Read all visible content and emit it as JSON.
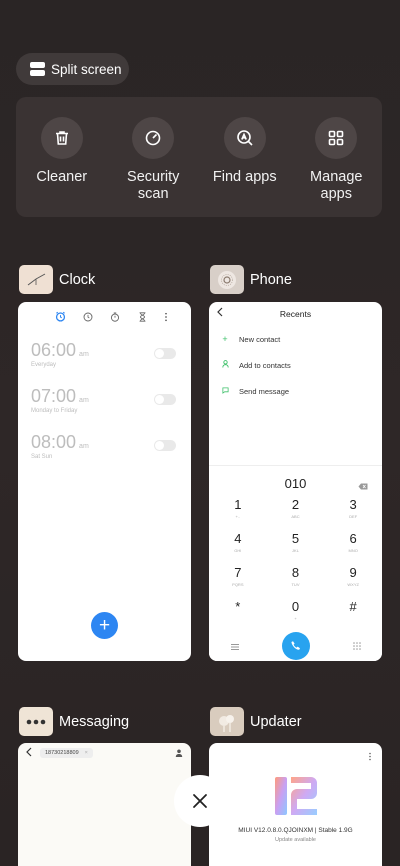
{
  "split_screen": "Split screen",
  "tools": [
    {
      "label": "Cleaner",
      "icon": "trash-icon"
    },
    {
      "label": "Security scan",
      "icon": "shield-scan-icon"
    },
    {
      "label": "Find apps",
      "icon": "search-apps-icon"
    },
    {
      "label": "Manage apps",
      "icon": "grid-icon"
    }
  ],
  "apps": {
    "clock": {
      "name": "Clock",
      "alarms": [
        {
          "time": "06:00",
          "ampm": "am",
          "repeat": "Everyday"
        },
        {
          "time": "07:00",
          "ampm": "am",
          "repeat": "Monday to Friday"
        },
        {
          "time": "08:00",
          "ampm": "am",
          "repeat": "Sat Sun"
        }
      ],
      "add": "+"
    },
    "phone": {
      "name": "Phone",
      "title": "Recents",
      "actions": [
        "New contact",
        "Add to contacts",
        "Send message"
      ],
      "number": "010",
      "keys": [
        {
          "d": "1",
          "l": "+.."
        },
        {
          "d": "2",
          "l": "ABC"
        },
        {
          "d": "3",
          "l": "DEF"
        },
        {
          "d": "4",
          "l": "GHI"
        },
        {
          "d": "5",
          "l": "JKL"
        },
        {
          "d": "6",
          "l": "MNO"
        },
        {
          "d": "7",
          "l": "PQRS"
        },
        {
          "d": "8",
          "l": "TUV"
        },
        {
          "d": "9",
          "l": "WXYZ"
        },
        {
          "d": "*",
          "l": ""
        },
        {
          "d": "0",
          "l": "+"
        },
        {
          "d": "#",
          "l": ""
        }
      ]
    },
    "messaging": {
      "name": "Messaging",
      "recipient": "18730218809"
    },
    "updater": {
      "name": "Updater",
      "version": "MIUI V12.0.8.0.QJOINXM | Stable 1.9G",
      "status": "Update available"
    }
  },
  "colors": {
    "accent_blue": "#2d86f2",
    "call_blue": "#28a3ef",
    "bg": "#2c2626"
  }
}
